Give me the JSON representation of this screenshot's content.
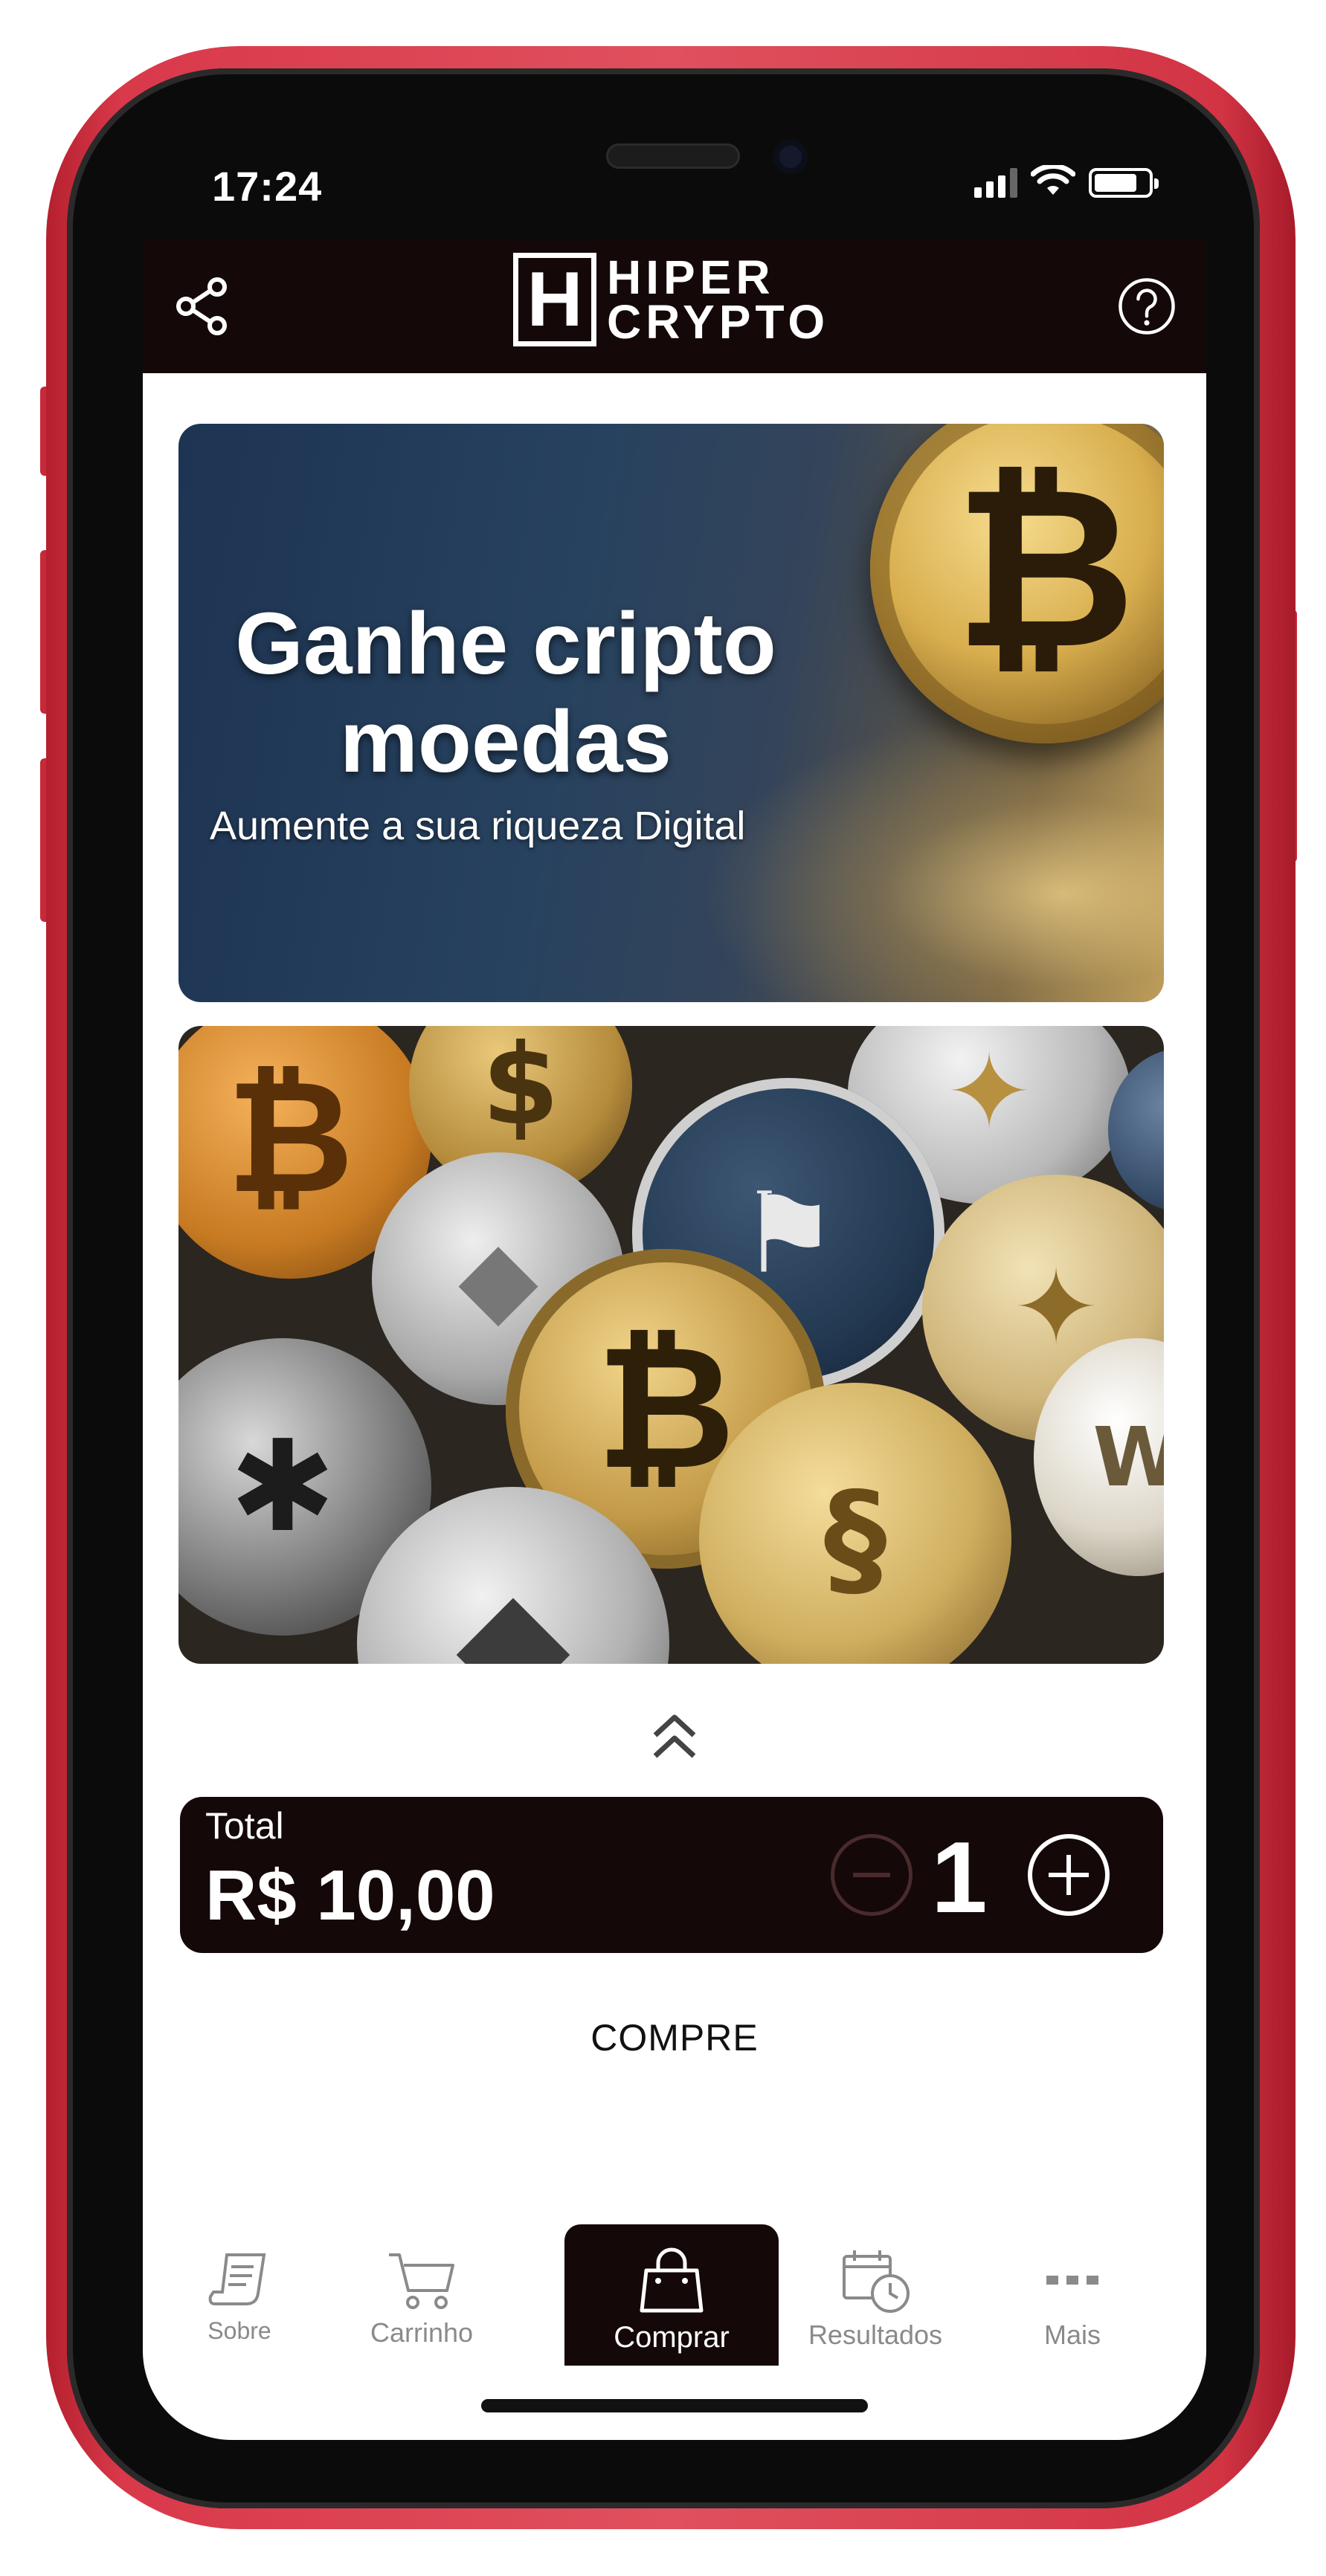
{
  "status_bar": {
    "time": "17:24"
  },
  "header": {
    "logo_letter": "H",
    "logo_line1": "HIPER",
    "logo_line2": "CRYPTO",
    "share_icon": "share-icon",
    "help_icon": "help-icon"
  },
  "banner": {
    "title_line1": "Ganhe cripto",
    "title_line2": "moedas",
    "subtitle": "Aumente a sua riqueza Digital"
  },
  "order": {
    "total_label": "Total",
    "total_value": "R$ 10,00",
    "quantity": "1"
  },
  "buy_button": "COMPRE",
  "tabbar": {
    "items": [
      {
        "label": "Sobre",
        "icon": "receipt-icon"
      },
      {
        "label": "Carrinho",
        "icon": "cart-icon"
      },
      {
        "label": "Comprar",
        "icon": "shopping-bag-icon",
        "active": true
      },
      {
        "label": "Resultados",
        "icon": "calendar-clock-icon"
      },
      {
        "label": "Mais",
        "icon": "more-dots-icon"
      }
    ]
  },
  "colors": {
    "header_bg": "#140809",
    "phone_frame": "#d9394a",
    "tab_inactive": "#8a8a8a"
  }
}
